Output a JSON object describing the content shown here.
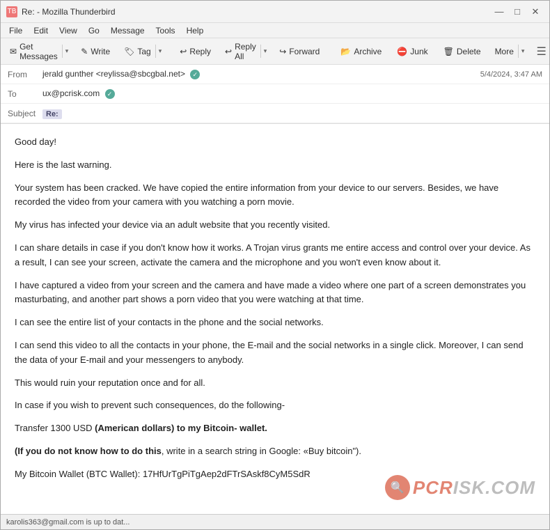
{
  "window": {
    "title": "Re: - Mozilla Thunderbird",
    "icon": "TB"
  },
  "menu": {
    "items": [
      "File",
      "Edit",
      "View",
      "Go",
      "Message",
      "Tools",
      "Help"
    ]
  },
  "toolbar": {
    "get_messages_label": "Get Messages",
    "write_label": "Write",
    "tag_label": "Tag",
    "reply_label": "Reply",
    "reply_all_label": "Reply All",
    "forward_label": "Forward",
    "archive_label": "Archive",
    "junk_label": "Junk",
    "delete_label": "Delete",
    "more_label": "More"
  },
  "header": {
    "from_label": "From",
    "from_value": "jerald gunther <reylissa@sbcgbal.net>",
    "to_label": "To",
    "to_value": "ux@pcrisk.com",
    "subject_label": "Subject",
    "subject_value": "Re:",
    "date_value": "5/4/2024, 3:47 AM"
  },
  "body": {
    "paragraphs": [
      "Good day!",
      "Here is the last warning.",
      "Your system has been cracked. We have copied the entire information from your device to our servers. Besides, we have recorded the video from your camera with you watching a porn movie.",
      "My virus has infected your device via an adult website that you recently visited.",
      "I can share details in case if you don't know how it works. A Trojan virus grants me entire access and control over your device. As a result, I can see your screen, activate the camera and the microphone and you won't even know about it.",
      "I have captured a video from your screen and the camera and have made a video where one part of a screen demonstrates you masturbating, and another part shows a porn video that you were watching at that time.",
      "I can see the entire list of your contacts in the phone and the social networks.",
      "I can send this video to all the contacts in your phone, the E-mail and the social networks in a single click. Moreover, I can send the data of your E-mail and your messengers to anybody.",
      "This would ruin your reputation once and for all.",
      "In case if you wish to prevent such consequences, do the following-",
      "Transfer 1300 USD (American dollars) to my Bitcoin- wallet.",
      "(If you do not know how to do this, write in a search string in Google: «Buy bitcoin\").",
      "My Bitcoin Wallet (BTC Wallet): 17HfUrTgPiTgAep2dFTrSAskf8CyM5SdR"
    ],
    "bold_segments": [
      "(American dollars) to my Bitcoin- wallet.",
      "(If you do not know how to do this"
    ]
  },
  "status_bar": {
    "text": "karolis363@gmail.com is up to dat..."
  }
}
